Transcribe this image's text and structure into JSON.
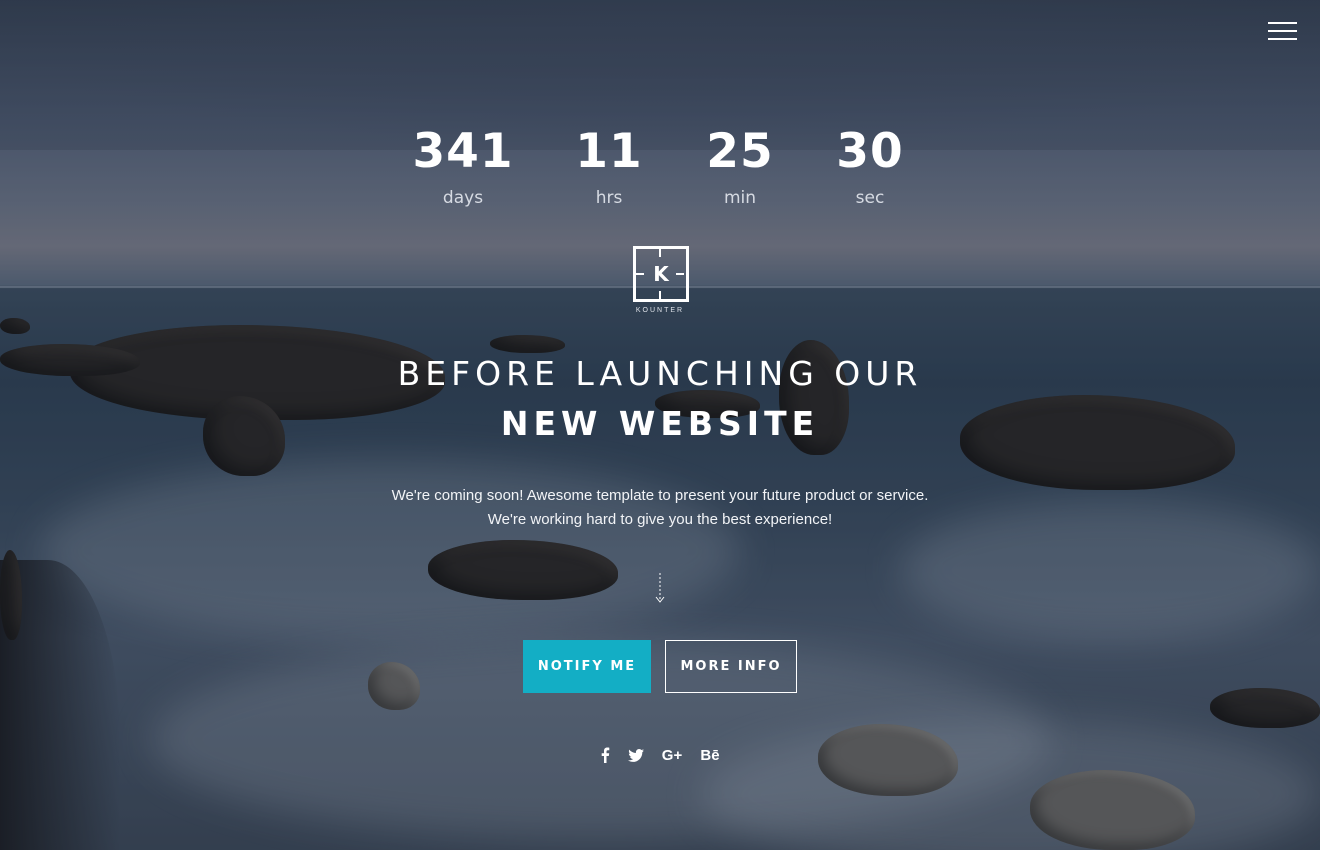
{
  "menu": {
    "icon": "hamburger-menu-icon"
  },
  "countdown": [
    {
      "value": "341",
      "label": "days"
    },
    {
      "value": "11",
      "label": "hrs"
    },
    {
      "value": "25",
      "label": "min"
    },
    {
      "value": "30",
      "label": "sec"
    }
  ],
  "logo": {
    "letter": "K",
    "brand": "KOUNTER"
  },
  "headline": {
    "line1": "BEFORE LAUNCHING OUR",
    "line2": "NEW WEBSITE"
  },
  "tagline": [
    "We're coming soon! Awesome template to present your future product or service.",
    "We're working hard to give you the best experience!"
  ],
  "buttons": {
    "notify": "NOTIFY ME",
    "more": "MORE INFO"
  },
  "social": [
    {
      "name": "facebook-icon"
    },
    {
      "name": "twitter-icon"
    },
    {
      "name": "google-plus-icon",
      "text": "G+"
    },
    {
      "name": "behance-icon",
      "text": "Bē"
    }
  ],
  "colors": {
    "accent": "#13aec5",
    "text": "#ffffff"
  }
}
